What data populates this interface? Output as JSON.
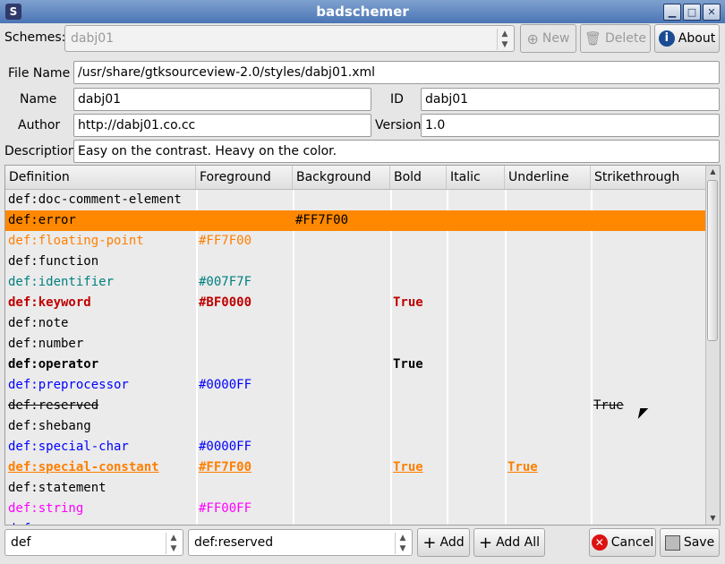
{
  "window": {
    "title": "badschemer"
  },
  "toolbar": {
    "schemes_label": "Schemes:",
    "scheme_selected": "dabj01",
    "new_label": "New",
    "delete_label": "Delete",
    "about_label": "About"
  },
  "form": {
    "file_name_label": "File Name",
    "file_name_value": "/usr/share/gtksourceview-2.0/styles/dabj01.xml",
    "name_label": "Name",
    "name_value": "dabj01",
    "id_label": "ID",
    "id_value": "dabj01",
    "author_label": "Author",
    "author_value": "http://dabj01.co.cc",
    "version_label": "Version",
    "version_value": "1.0",
    "description_label": "Description",
    "description_value": "Easy on the contrast. Heavy on the color."
  },
  "table": {
    "columns": [
      "Definition",
      "Foreground",
      "Background",
      "Bold",
      "Italic",
      "Underline",
      "Strikethrough"
    ],
    "rows": [
      {
        "def": "def:doc-comment-element",
        "fg": "",
        "bg": "",
        "bold": "",
        "italic": "",
        "underline": "",
        "strike": "",
        "color": "#000000",
        "style": "normal"
      },
      {
        "def": "def:error",
        "fg": "",
        "bg": "#FF7F00",
        "bold": "",
        "italic": "",
        "underline": "",
        "strike": "",
        "color": "#000000",
        "style": "highlight"
      },
      {
        "def": "def:floating-point",
        "fg": "#FF7F00",
        "bg": "",
        "bold": "",
        "italic": "",
        "underline": "",
        "strike": "",
        "color": "#FF7F00",
        "style": "normal"
      },
      {
        "def": "def:function",
        "fg": "",
        "bg": "",
        "bold": "",
        "italic": "",
        "underline": "",
        "strike": "",
        "color": "#000000",
        "style": "normal"
      },
      {
        "def": "def:identifier",
        "fg": "#007F7F",
        "bg": "",
        "bold": "",
        "italic": "",
        "underline": "",
        "strike": "",
        "color": "#007F7F",
        "style": "normal"
      },
      {
        "def": "def:keyword",
        "fg": "#BF0000",
        "bg": "",
        "bold": "True",
        "italic": "",
        "underline": "",
        "strike": "",
        "color": "#BF0000",
        "style": "bold"
      },
      {
        "def": "def:note",
        "fg": "",
        "bg": "",
        "bold": "",
        "italic": "",
        "underline": "",
        "strike": "",
        "color": "#000000",
        "style": "normal"
      },
      {
        "def": "def:number",
        "fg": "",
        "bg": "",
        "bold": "",
        "italic": "",
        "underline": "",
        "strike": "",
        "color": "#000000",
        "style": "normal"
      },
      {
        "def": "def:operator",
        "fg": "",
        "bg": "",
        "bold": "True",
        "italic": "",
        "underline": "",
        "strike": "",
        "color": "#000000",
        "style": "bold"
      },
      {
        "def": "def:preprocessor",
        "fg": "#0000FF",
        "bg": "",
        "bold": "",
        "italic": "",
        "underline": "",
        "strike": "",
        "color": "#0000FF",
        "style": "normal"
      },
      {
        "def": "def:reserved",
        "fg": "",
        "bg": "",
        "bold": "",
        "italic": "",
        "underline": "",
        "strike": "True",
        "color": "#000000",
        "style": "strike"
      },
      {
        "def": "def:shebang",
        "fg": "",
        "bg": "",
        "bold": "",
        "italic": "",
        "underline": "",
        "strike": "",
        "color": "#000000",
        "style": "normal"
      },
      {
        "def": "def:special-char",
        "fg": "#0000FF",
        "bg": "",
        "bold": "",
        "italic": "",
        "underline": "",
        "strike": "",
        "color": "#0000FF",
        "style": "normal"
      },
      {
        "def": "def:special-constant",
        "fg": "#FF7F00",
        "bg": "",
        "bold": "True",
        "italic": "",
        "underline": "True",
        "strike": "",
        "color": "#FF7F00",
        "style": "bold-underline"
      },
      {
        "def": "def:statement",
        "fg": "",
        "bg": "",
        "bold": "",
        "italic": "",
        "underline": "",
        "strike": "",
        "color": "#000000",
        "style": "normal"
      },
      {
        "def": "def:string",
        "fg": "#FF00FF",
        "bg": "",
        "bold": "",
        "italic": "",
        "underline": "",
        "strike": "",
        "color": "#FF00FF",
        "style": "normal"
      },
      {
        "def": "def:",
        "fg": "",
        "bg": "",
        "bold": "",
        "italic": "",
        "underline": "",
        "strike": "",
        "color": "#0000FF",
        "style": "normal"
      }
    ]
  },
  "bottom": {
    "prefix_value": "def",
    "definition_value": "def:reserved",
    "add_label": "Add",
    "add_all_label": "Add All",
    "cancel_label": "Cancel",
    "save_label": "Save"
  },
  "colors": {
    "highlight": "#FF8800",
    "titlebar": "#5a82bd"
  }
}
